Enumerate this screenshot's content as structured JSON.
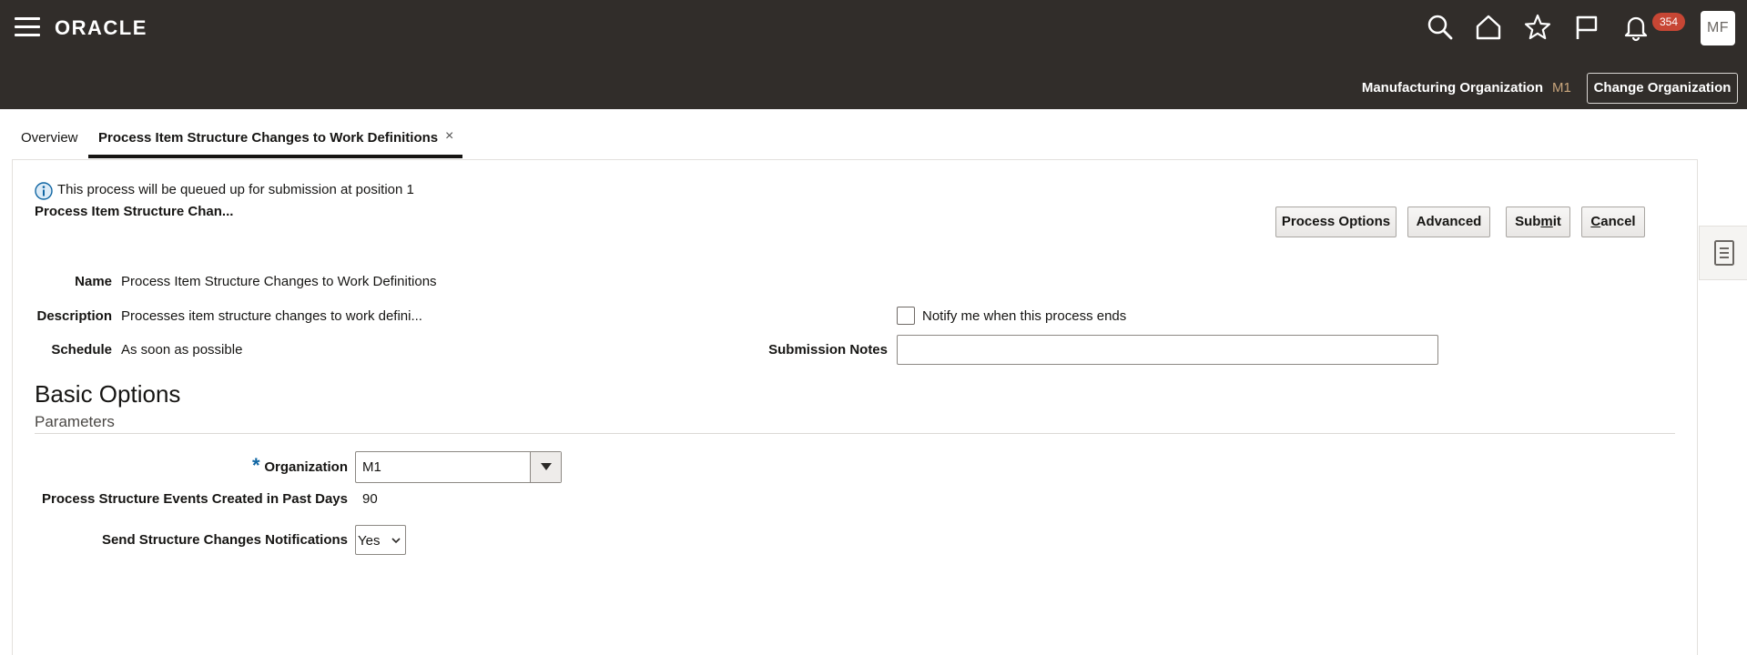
{
  "header": {
    "brand": "ORACLE",
    "notification_count": "354",
    "avatar_initials": "MF",
    "org_label": "Manufacturing Organization",
    "org_value": "M1",
    "change_org_label": "Change Organization"
  },
  "tabs": [
    {
      "label": "Overview"
    },
    {
      "label": "Process Item Structure Changes to Work Definitions"
    }
  ],
  "tab_close_glyph": "×",
  "info": {
    "message": "This process will be queued up for submission at position 1",
    "process_title": "Process Item Structure Chan..."
  },
  "buttons": {
    "process_options": "Process Options",
    "advanced": "Advanced",
    "submit_pre": "Sub",
    "submit_ul": "m",
    "submit_post": "it",
    "cancel_ul": "C",
    "cancel_post": "ancel"
  },
  "details": {
    "name_label": "Name",
    "name_value": "Process Item Structure Changes to Work Definitions",
    "description_label": "Description",
    "description_value": "Processes item structure changes to work defini...",
    "schedule_label": "Schedule",
    "schedule_value": "As soon as possible",
    "notify_label": "Notify me when this process ends",
    "submission_notes_label": "Submission Notes",
    "submission_notes_value": ""
  },
  "basic_options": {
    "title": "Basic Options",
    "parameters_title": "Parameters",
    "required_mark": "*",
    "organization_label": "Organization",
    "organization_value": "M1",
    "past_days_label": "Process Structure Events Created in Past Days",
    "past_days_value": "90",
    "send_notifications_label": "Send Structure Changes Notifications",
    "send_notifications_value": "Yes"
  },
  "icons": [
    "hamburger-icon",
    "oracle-logo",
    "search-icon",
    "home-icon",
    "star-icon",
    "flag-icon",
    "bell-icon",
    "info-icon",
    "chevron-down-icon",
    "document-icon"
  ],
  "colors": {
    "header_bg": "#312d2a",
    "badge": "#c74634",
    "org_value": "#c9a67d",
    "info_blue": "#1066a3"
  }
}
